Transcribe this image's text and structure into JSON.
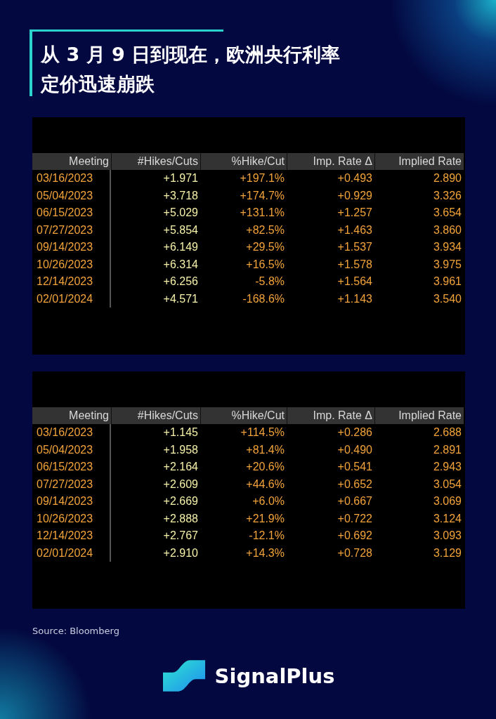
{
  "title": [
    "从 3 月 9 日到现在，欧洲央行利率",
    "定价迅速崩跌"
  ],
  "tables": [
    {
      "columns": [
        "Meeting",
        "#Hikes/Cuts",
        "%Hike/Cut",
        "Imp. Rate Δ",
        "Implied Rate"
      ],
      "rows": [
        [
          "03/16/2023",
          "+1.971",
          "+197.1%",
          "+0.493",
          "2.890"
        ],
        [
          "05/04/2023",
          "+3.718",
          "+174.7%",
          "+0.929",
          "3.326"
        ],
        [
          "06/15/2023",
          "+5.029",
          "+131.1%",
          "+1.257",
          "3.654"
        ],
        [
          "07/27/2023",
          "+5.854",
          "+82.5%",
          "+1.463",
          "3.860"
        ],
        [
          "09/14/2023",
          "+6.149",
          "+29.5%",
          "+1.537",
          "3.934"
        ],
        [
          "10/26/2023",
          "+6.314",
          "+16.5%",
          "+1.578",
          "3.975"
        ],
        [
          "12/14/2023",
          "+6.256",
          "-5.8%",
          "+1.564",
          "3.961"
        ],
        [
          "02/01/2024",
          "+4.571",
          "-168.6%",
          "+1.143",
          "3.540"
        ]
      ]
    },
    {
      "columns": [
        "Meeting",
        "#Hikes/Cuts",
        "%Hike/Cut",
        "Imp. Rate Δ",
        "Implied Rate"
      ],
      "rows": [
        [
          "03/16/2023",
          "+1.145",
          "+114.5%",
          "+0.286",
          "2.688"
        ],
        [
          "05/04/2023",
          "+1.958",
          "+81.4%",
          "+0.490",
          "2.891"
        ],
        [
          "06/15/2023",
          "+2.164",
          "+20.6%",
          "+0.541",
          "2.943"
        ],
        [
          "07/27/2023",
          "+2.609",
          "+44.6%",
          "+0.652",
          "3.054"
        ],
        [
          "09/14/2023",
          "+2.669",
          "+6.0%",
          "+0.667",
          "3.069"
        ],
        [
          "10/26/2023",
          "+2.888",
          "+21.9%",
          "+0.722",
          "3.124"
        ],
        [
          "12/14/2023",
          "+2.767",
          "-12.1%",
          "+0.692",
          "3.093"
        ],
        [
          "02/01/2024",
          "+2.910",
          "+14.3%",
          "+0.728",
          "3.129"
        ]
      ]
    }
  ],
  "source": "Source: Bloomberg",
  "brand": "SignalPlus"
}
